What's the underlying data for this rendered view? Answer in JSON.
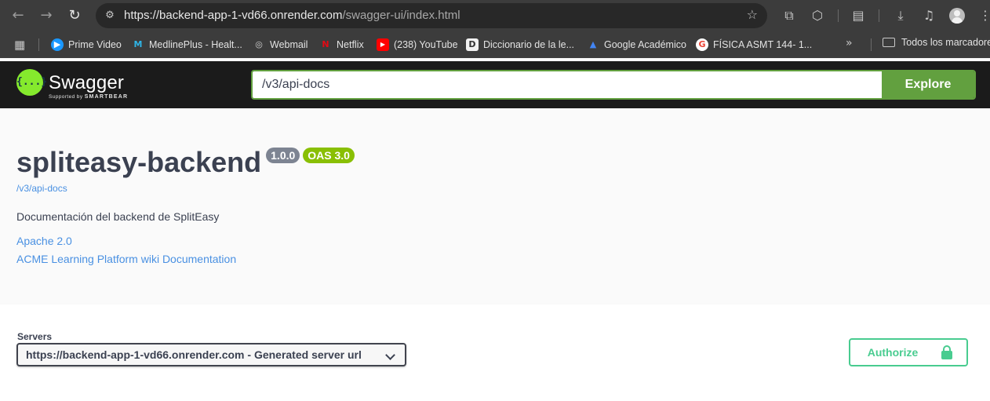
{
  "browser": {
    "url_host": "https://backend-app-1-vd66.onrender.com",
    "url_path": "/swagger-ui/index.html",
    "icons": {
      "back": "arrow-left-icon",
      "forward": "arrow-right-icon",
      "reload": "reload-icon",
      "site_info": "tune-icon",
      "bookmark": "star-icon",
      "extensions": "puzzle-icon",
      "reading_mode": "reading-mode-icon",
      "downloads": "download-icon",
      "media": "media-control-icon",
      "profile": "avatar-icon",
      "menu": "kebab-menu-icon"
    },
    "bookmarks": [
      {
        "label": "Prime Video",
        "color": "#1a98ff",
        "glyph": "▶"
      },
      {
        "label": "MedlinePlus - Healt...",
        "color": "#2a7ab0",
        "glyph": "M"
      },
      {
        "label": "Webmail",
        "color": "#9aa0a6",
        "glyph": "◎"
      },
      {
        "label": "Netflix",
        "color": "#e50914",
        "glyph": "N"
      },
      {
        "label": "(238) YouTube",
        "color": "#ff0000",
        "glyph": "▶"
      },
      {
        "label": "Diccionario de la le...",
        "color": "#f1f1f1",
        "glyph": "D"
      },
      {
        "label": "Google Académico",
        "color": "#4285f4",
        "glyph": "▲"
      },
      {
        "label": "FÍSICA ASMT 144- 1...",
        "color": "#ffffff",
        "glyph": "G"
      }
    ],
    "bookmarks_folder": "Todos los marcadores"
  },
  "swagger": {
    "logo_text": "Swagger",
    "logo_glyph": "{...}",
    "logo_sub_prefix": "Supported by",
    "logo_sub_brand": "SMARTBEAR",
    "explore_value": "/v3/api-docs",
    "explore_label": "Explore",
    "accent": "#62a03f"
  },
  "info": {
    "title": "spliteasy-backend",
    "version": "1.0.0",
    "oas": "OAS 3.0",
    "spec_url": "/v3/api-docs",
    "description": "Documentación del backend de SplitEasy",
    "license": "Apache 2.0",
    "external_docs": "ACME Learning Platform wiki Documentation"
  },
  "servers": {
    "label": "Servers",
    "selected": "https://backend-app-1-vd66.onrender.com - Generated server url"
  },
  "authorize": {
    "label": "Authorize",
    "color": "#49cc90"
  }
}
